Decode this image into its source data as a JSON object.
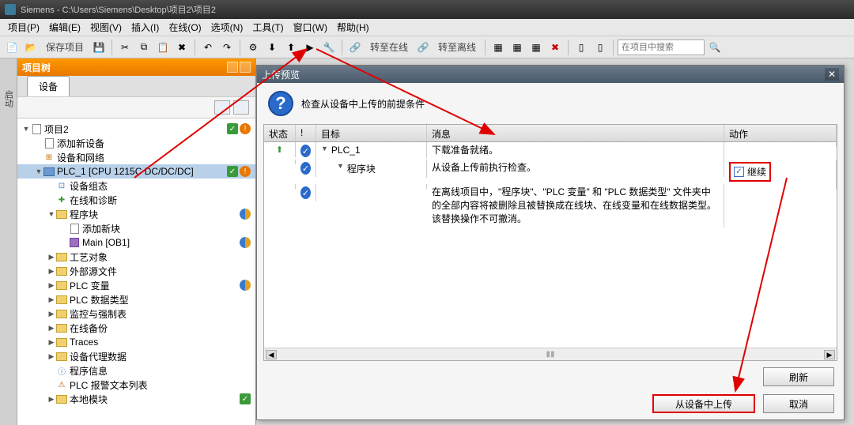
{
  "title_bar": "Siemens   -   C:\\Users\\Siemens\\Desktop\\项目2\\项目2",
  "menus": [
    "项目(P)",
    "编辑(E)",
    "视图(V)",
    "插入(I)",
    "在线(O)",
    "选项(N)",
    "工具(T)",
    "窗口(W)",
    "帮助(H)"
  ],
  "toolbar": {
    "save_project": "保存项目",
    "go_online": "转至在线",
    "go_offline": "转至离线",
    "search_placeholder": "在项目中搜索"
  },
  "side_tab": "启动",
  "project_tree": {
    "title": "项目树",
    "tab": "设备",
    "root": "项目2",
    "items": [
      {
        "indent": 1,
        "icon": "doc",
        "label": "添加新设备"
      },
      {
        "indent": 1,
        "icon": "net",
        "label": "设备和网络"
      },
      {
        "indent": 1,
        "icon": "plc",
        "label": "PLC_1 [CPU 1215C DC/DC/DC]",
        "exp": "▼",
        "selected": true,
        "status": [
          "ok",
          "warn"
        ]
      },
      {
        "indent": 2,
        "icon": "cfg",
        "label": "设备组态"
      },
      {
        "indent": 2,
        "icon": "diag",
        "label": "在线和诊断"
      },
      {
        "indent": 2,
        "icon": "folder",
        "label": "程序块",
        "exp": "▼",
        "status": [
          "half"
        ]
      },
      {
        "indent": 3,
        "icon": "doc",
        "label": "添加新块"
      },
      {
        "indent": 3,
        "icon": "block",
        "label": "Main [OB1]",
        "status": [
          "half"
        ]
      },
      {
        "indent": 2,
        "icon": "folder",
        "label": "工艺对象",
        "exp": "▶"
      },
      {
        "indent": 2,
        "icon": "folder",
        "label": "外部源文件",
        "exp": "▶"
      },
      {
        "indent": 2,
        "icon": "folder",
        "label": "PLC 变量",
        "exp": "▶",
        "status": [
          "half"
        ]
      },
      {
        "indent": 2,
        "icon": "folder",
        "label": "PLC 数据类型",
        "exp": "▶"
      },
      {
        "indent": 2,
        "icon": "folder",
        "label": "监控与强制表",
        "exp": "▶"
      },
      {
        "indent": 2,
        "icon": "folder",
        "label": "在线备份",
        "exp": "▶"
      },
      {
        "indent": 2,
        "icon": "folder",
        "label": "Traces",
        "exp": "▶"
      },
      {
        "indent": 2,
        "icon": "folder",
        "label": "设备代理数据",
        "exp": "▶"
      },
      {
        "indent": 2,
        "icon": "info",
        "label": "程序信息"
      },
      {
        "indent": 2,
        "icon": "alarm",
        "label": "PLC 报警文本列表"
      },
      {
        "indent": 2,
        "icon": "folder",
        "label": "本地模块",
        "exp": "▶",
        "status": [
          "ok"
        ]
      }
    ],
    "root_status": [
      "ok",
      "warn"
    ]
  },
  "dialog": {
    "title": "上传预览",
    "header": "检查从设备中上传的前提条件",
    "columns": {
      "status": "状态",
      "bang": "!",
      "target": "目标",
      "msg": "消息",
      "action": "动作"
    },
    "rows": [
      {
        "status": "up",
        "bang": "ok",
        "target_exp": "▼",
        "target": "PLC_1",
        "msg": "下载准备就绪。",
        "action": ""
      },
      {
        "status": "",
        "bang": "ok",
        "target_exp": "▼",
        "target": "程序块",
        "msg": "从设备上传前执行检查。",
        "action": "继续",
        "action_check": true,
        "highlight": true
      },
      {
        "status": "",
        "bang": "ok",
        "target": "",
        "msg": "在离线项目中，\"程序块\"、\"PLC 变量\" 和 \"PLC 数据类型\" 文件夹中的全部内容将被删除且被替换成在线块、在线变量和在线数据类型。该替换操作不可撤消。",
        "action": ""
      }
    ],
    "refresh": "刷新",
    "upload": "从设备中上传",
    "cancel": "取消"
  }
}
